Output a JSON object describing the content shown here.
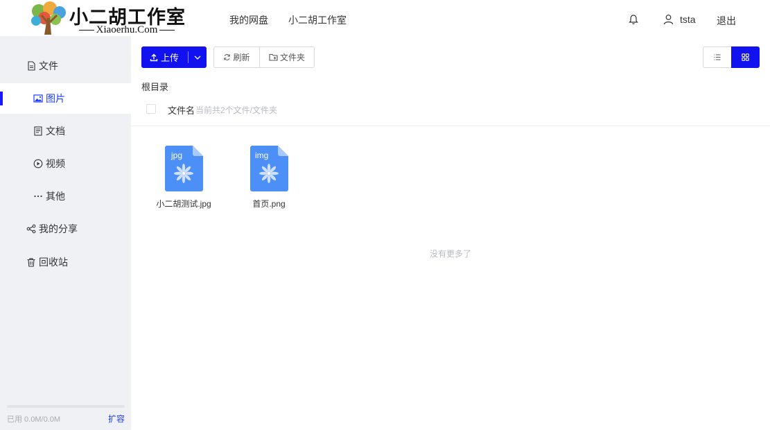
{
  "header": {
    "logo_title": "小二胡工作室",
    "logo_subtitle": "Xiaoerhu.Com",
    "nav": [
      "我的网盘",
      "小二胡工作室"
    ],
    "username": "tsta",
    "logout": "退出"
  },
  "sidebar": {
    "items": [
      {
        "label": "文件",
        "icon": "file-icon"
      },
      {
        "label": "图片",
        "icon": "image-icon",
        "active": true
      },
      {
        "label": "文档",
        "icon": "document-icon"
      },
      {
        "label": "视频",
        "icon": "video-icon"
      },
      {
        "label": "其他",
        "icon": "more-icon"
      },
      {
        "label": "我的分享",
        "icon": "share-icon"
      },
      {
        "label": "回收站",
        "icon": "trash-icon"
      }
    ],
    "quota_text": "已用 0.0M/0.0M",
    "quota_used_fraction": 0,
    "expand_label": "扩容"
  },
  "toolbar": {
    "upload_label": "上传",
    "refresh_label": "刷新",
    "folder_label": "文件夹"
  },
  "breadcrumb": "根目录",
  "list_header": {
    "name_label": "文件名",
    "count_text": "当前共2个文件/文件夹"
  },
  "files": [
    {
      "name": "小二胡测试.jpg",
      "badge": "jpg"
    },
    {
      "name": "首页.png",
      "badge": "img"
    }
  ],
  "end_text": "没有更多了",
  "colors": {
    "primary": "#1212f0",
    "file_icon": "#4b8ff7",
    "sidebar_bg": "#f0f1f5"
  }
}
